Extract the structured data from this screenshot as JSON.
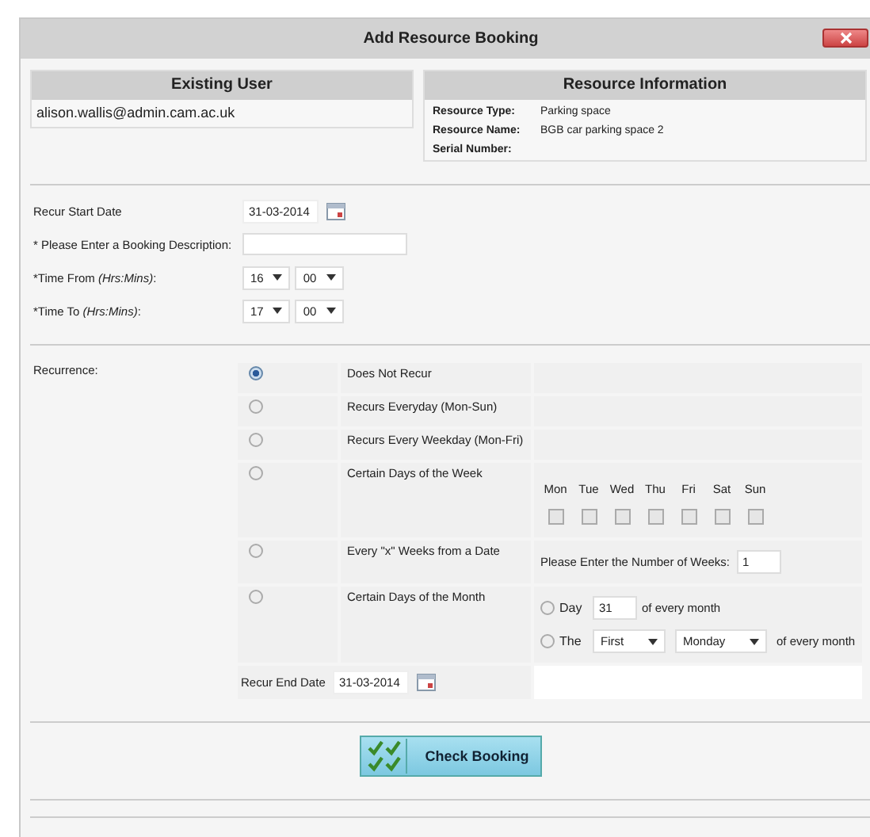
{
  "window": {
    "title": "Add Resource Booking"
  },
  "existing_user": {
    "heading": "Existing User",
    "email": "alison.wallis@admin.cam.ac.uk"
  },
  "resource_info": {
    "heading": "Resource Information",
    "fields": [
      {
        "label": "Resource Type:",
        "value": "Parking space"
      },
      {
        "label": "Resource Name:",
        "value": "BGB car parking space 2"
      },
      {
        "label": "Serial Number:"
      }
    ]
  },
  "form": {
    "start_date": {
      "label": "Recur Start Date",
      "value": "31-03-2014"
    },
    "description": {
      "label": "* Please Enter a Booking Description:"
    },
    "times": [
      {
        "label": "*Time From *(Hrs:Mins)*:",
        "hour": "16",
        "minute": "00"
      },
      {
        "label": "*Time To *(Hrs:Mins)*:",
        "hour": "17",
        "minute": "00"
      }
    ]
  },
  "recurrence": {
    "label": "Recurrence:",
    "options": [
      {
        "kind": "plain",
        "label": "Does Not Recur",
        "selected": true
      },
      {
        "kind": "plain",
        "label": "Recurs Everyday (Mon-Sun)",
        "selected": false
      },
      {
        "kind": "plain",
        "label": "Recurs Every Weekday (Mon-Fri)",
        "selected": false
      },
      {
        "kind": "days",
        "label": "Certain Days of the Week",
        "selected": false,
        "days": [
          {
            "label": "Mon",
            "checked": false
          },
          {
            "label": "Tue",
            "checked": false
          },
          {
            "label": "Wed",
            "checked": false
          },
          {
            "label": "Thu",
            "checked": false
          },
          {
            "label": "Fri",
            "checked": false
          },
          {
            "label": "Sat",
            "checked": false
          },
          {
            "label": "Sun",
            "checked": false
          }
        ]
      },
      {
        "kind": "weeks",
        "label": "Every \"x\" Weeks from a Date",
        "selected": false,
        "prompt": "Please Enter the Number of Weeks:",
        "value": "1"
      },
      {
        "kind": "month",
        "label": "Certain Days of the Month",
        "selected": false,
        "day_option": {
          "label": "Day",
          "selected": false,
          "value": "31",
          "suffix": "of every month"
        },
        "the_option": {
          "label": "The",
          "selected": false,
          "ordinal": "First",
          "weekday": "Monday",
          "suffix": "of every month"
        }
      }
    ],
    "end_date": {
      "label": "Recur End Date",
      "value": "31-03-2014"
    }
  },
  "check_button": {
    "label": "Check Booking"
  }
}
